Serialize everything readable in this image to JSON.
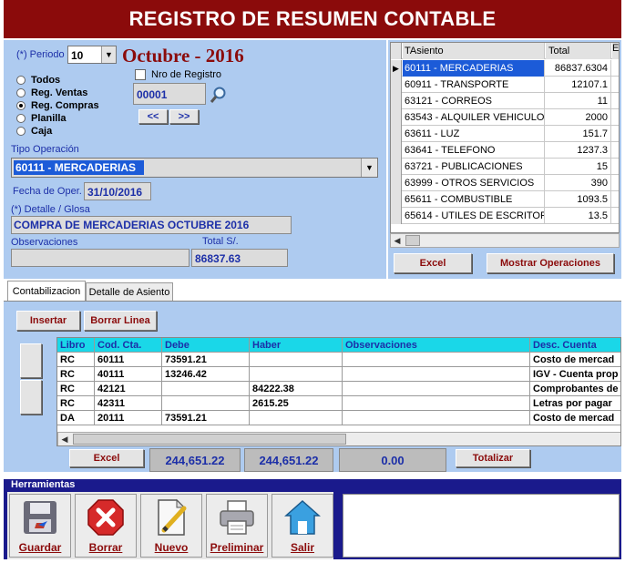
{
  "window": {
    "title": "REGISTRO DE RESUMEN CONTABLE"
  },
  "form": {
    "periodo_label": "(*) Periodo",
    "periodo_value": "10",
    "periodo_text": "Octubre - 2016",
    "nro_registro_label": "Nro de Registro",
    "nro_registro_value": "00001",
    "nav_prev": "<<",
    "nav_next": ">>",
    "radios": [
      {
        "label": "Todos",
        "checked": false
      },
      {
        "label": "Reg. Ventas",
        "checked": false
      },
      {
        "label": "Reg. Compras",
        "checked": true
      },
      {
        "label": "Planilla",
        "checked": false
      },
      {
        "label": "Caja",
        "checked": false
      }
    ],
    "tipo_operacion_label": "Tipo Operación",
    "tipo_operacion_value": "60111 - MERCADERIAS",
    "fecha_label": "Fecha de Oper.",
    "fecha_value": "31/10/2016",
    "detalle_label": "(*) Detalle / Glosa",
    "detalle_value": "COMPRA DE MERCADERIAS OCTUBRE 2016",
    "observaciones_label": "Observaciones",
    "observaciones_value": "",
    "total_label": "Total S/.",
    "total_value": "86837.63"
  },
  "asientos": {
    "headers": [
      "TAsiento",
      "Total",
      "E"
    ],
    "rows": [
      {
        "asiento": "60111 - MERCADERIAS",
        "total": "86837.6304"
      },
      {
        "asiento": "60911 - TRANSPORTE",
        "total": "12107.1"
      },
      {
        "asiento": "63121 - CORREOS",
        "total": "11"
      },
      {
        "asiento": "63543 - ALQUILER VEHICULO (",
        "total": "2000"
      },
      {
        "asiento": "63611 - LUZ",
        "total": "151.7"
      },
      {
        "asiento": "63641 - TELEFONO",
        "total": "1237.3"
      },
      {
        "asiento": "63721 - PUBLICACIONES",
        "total": "15"
      },
      {
        "asiento": "63999 - OTROS SERVICIOS",
        "total": "390"
      },
      {
        "asiento": "65611 - COMBUSTIBLE",
        "total": "1093.5"
      },
      {
        "asiento": "65614 - UTILES DE ESCRITOR",
        "total": "13.5"
      }
    ],
    "excel_label": "Excel",
    "mostrar_label": "Mostrar Operaciones"
  },
  "tabs": [
    {
      "label": "Contabilizacion",
      "active": true
    },
    {
      "label": "Detalle de Asiento",
      "active": false
    }
  ],
  "contab": {
    "insertar_label": "Insertar",
    "borrar_linea_label": "Borrar Linea",
    "headers": [
      "Libro",
      "Cod. Cta.",
      "Debe",
      "Haber",
      "Observaciones",
      "Desc. Cuenta"
    ],
    "rows": [
      [
        "RC",
        "60111",
        "73591.21",
        "",
        "",
        "Costo de mercad"
      ],
      [
        "RC",
        "40111",
        "13246.42",
        "",
        "",
        "IGV - Cuenta prop"
      ],
      [
        "RC",
        "42121",
        "",
        "84222.38",
        "",
        "Comprobantes de"
      ],
      [
        "RC",
        "42311",
        "",
        "2615.25",
        "",
        "Letras por pagar"
      ],
      [
        "DA",
        "20111",
        "73591.21",
        "",
        "",
        "Costo de mercad"
      ]
    ],
    "excel_label": "Excel",
    "total_debe": "244,651.22",
    "total_haber": "244,651.22",
    "diferencia": "0.00",
    "totalizar_label": "Totalizar"
  },
  "tools": {
    "header": "Herramientas",
    "buttons": [
      {
        "label": "Guardar",
        "icon": "floppy-disk-icon"
      },
      {
        "label": "Borrar",
        "icon": "delete-x-icon"
      },
      {
        "label": "Nuevo",
        "icon": "new-document-icon"
      },
      {
        "label": "Preliminar",
        "icon": "printer-icon"
      },
      {
        "label": "Salir",
        "icon": "home-icon"
      }
    ]
  },
  "colors": {
    "title_bg": "#8b0b0b",
    "panel_bg": "#aecbf0",
    "selection": "#1c5bd8",
    "grid_header": "#1ad7e8",
    "toolbar_bg": "#1a1a8c"
  }
}
